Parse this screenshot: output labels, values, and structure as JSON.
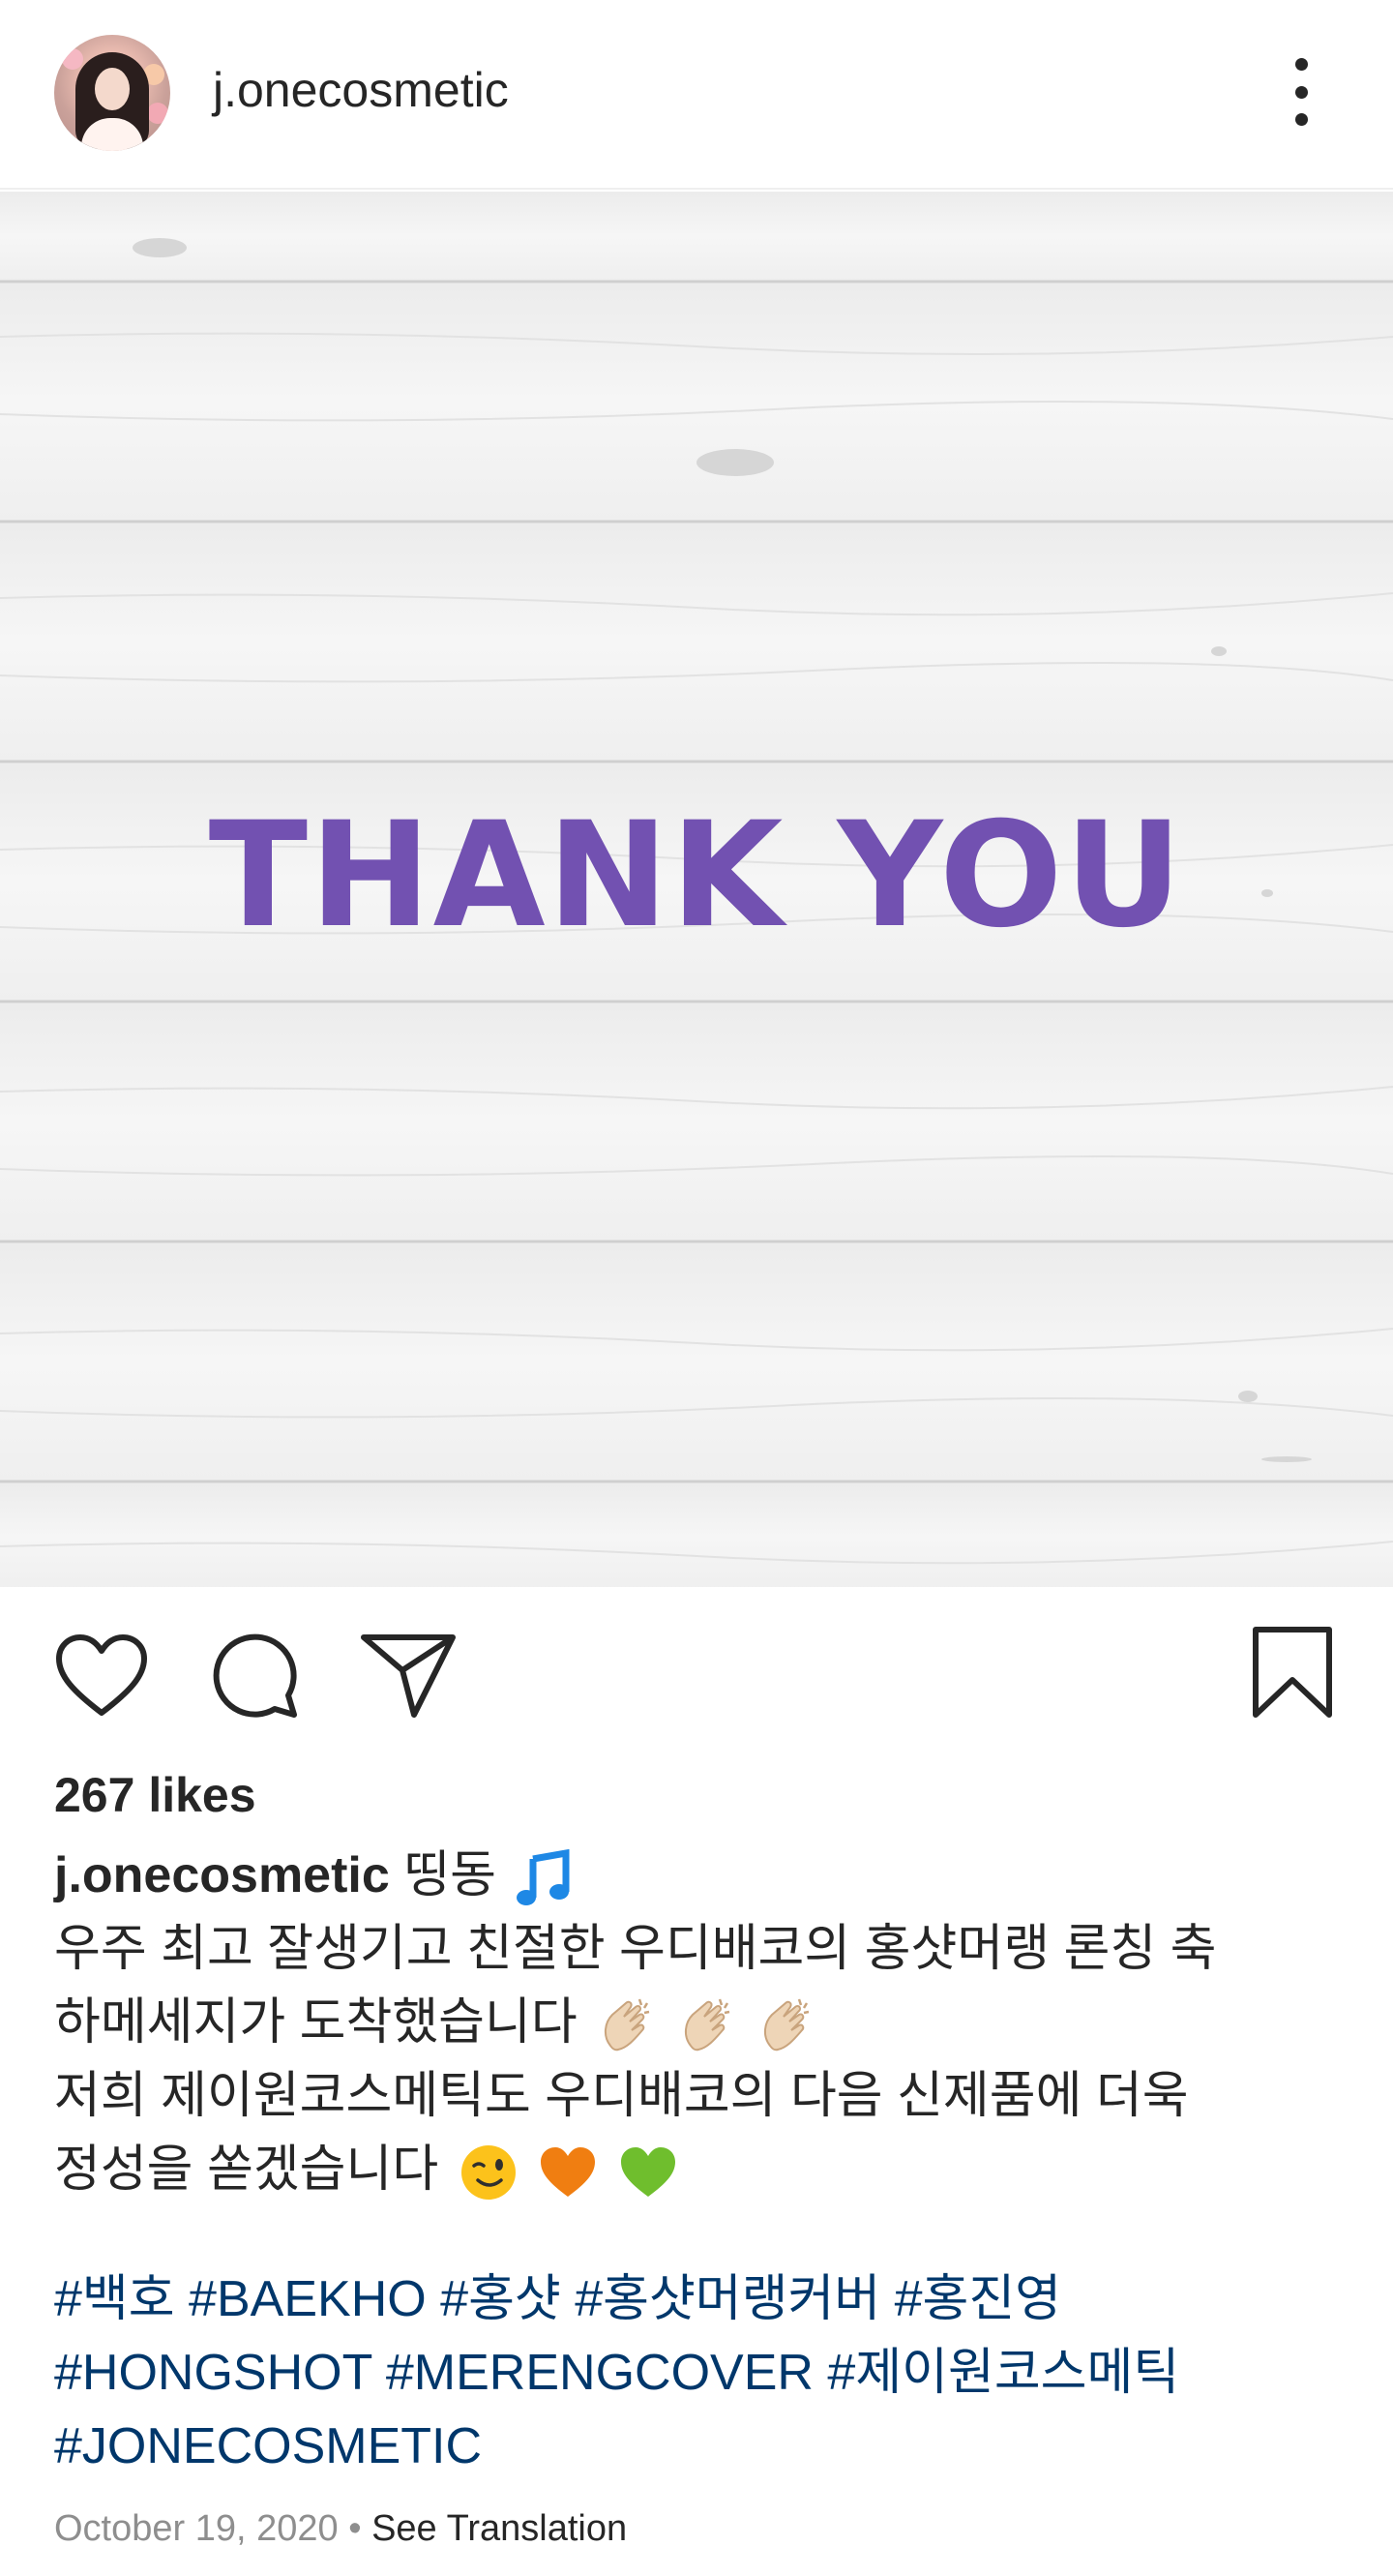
{
  "post": {
    "username": "j.onecosmetic",
    "image_text": "THANK YOU",
    "likes": "267 likes",
    "caption": {
      "username": "j.onecosmetic",
      "first_text": "띵동",
      "line2": "우주 최고 잘생기고 친절한 우디배코의 홍샷머랭 론칭 축",
      "line3": "하메세지가 도착했습니다",
      "line4": "저희 제이원코스메틱도 우디배코의 다음 신제품에 더욱",
      "line5": "정성을 쏟겠습니다"
    },
    "hashtags": {
      "line1": "#백호 #BAEKHO #홍샷 #홍샷머랭커버 #홍진영",
      "line2": "#HONGSHOT #MERENGCOVER #제이원코스메틱",
      "line3": "#JONECOSMETIC"
    },
    "date": "October 19, 2020",
    "separator": " • ",
    "see_translation": "See Translation"
  },
  "icons": {
    "more": "more-vertical-icon",
    "like": "heart-icon",
    "comment": "comment-icon",
    "share": "send-icon",
    "save": "bookmark-icon",
    "music": "musical-note-emoji",
    "clap": "clapping-hands-emoji",
    "wink": "winking-face-emoji",
    "orange_heart": "orange-heart-emoji",
    "green_heart": "green-heart-emoji"
  },
  "colors": {
    "image_text": "#7251b1",
    "hashtag": "#00376b",
    "meta": "#8e8e8e",
    "text": "#262626"
  }
}
